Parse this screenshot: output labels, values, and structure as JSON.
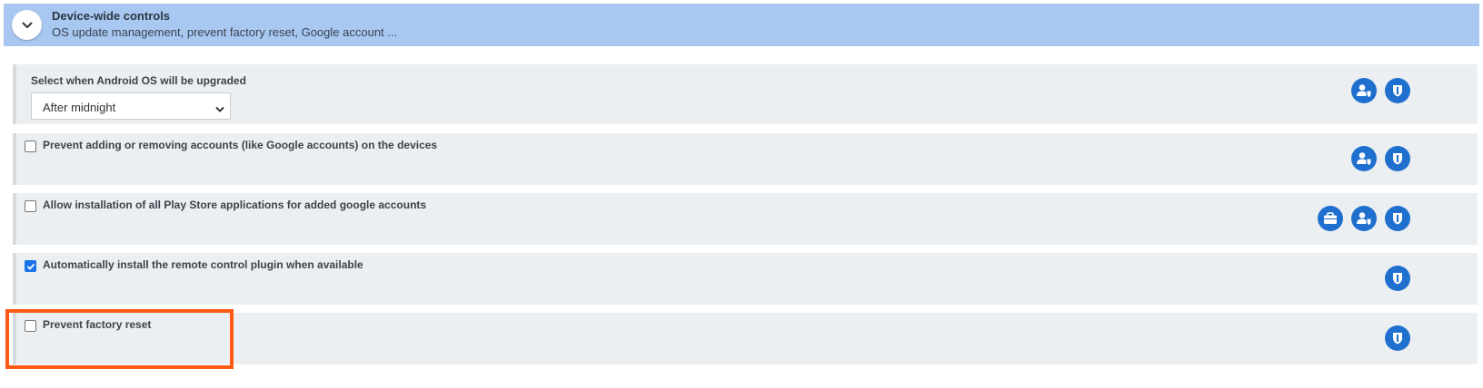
{
  "section": {
    "title": "Device-wide controls",
    "subtitle": "OS update management, prevent factory reset, Google account ...",
    "expand_icon": "chevron-down-icon"
  },
  "rows": [
    {
      "type": "select",
      "label": "Select when Android OS will be upgraded",
      "selected": "After midnight",
      "icons": [
        "user-shield-icon",
        "shield-icon"
      ]
    },
    {
      "type": "checkbox",
      "label": "Prevent adding or removing accounts (like Google accounts) on the devices",
      "checked": false,
      "icons": [
        "user-shield-icon",
        "shield-icon"
      ]
    },
    {
      "type": "checkbox",
      "label": "Allow installation of all Play Store applications for added google accounts",
      "checked": false,
      "icons": [
        "briefcase-icon",
        "user-shield-icon",
        "shield-icon"
      ]
    },
    {
      "type": "checkbox",
      "label": "Automatically install the remote control plugin when available",
      "checked": true,
      "icons": [
        "shield-icon"
      ]
    },
    {
      "type": "checkbox",
      "label": "Prevent factory reset",
      "checked": false,
      "highlighted": true,
      "icons": [
        "shield-icon"
      ]
    }
  ],
  "colors": {
    "header_bg": "#a8c8f2",
    "row_bg": "#ebeff1",
    "icon_bg": "#1f6fcf",
    "highlight": "#ff5a14",
    "checkbox_checked": "#1a73e8"
  }
}
